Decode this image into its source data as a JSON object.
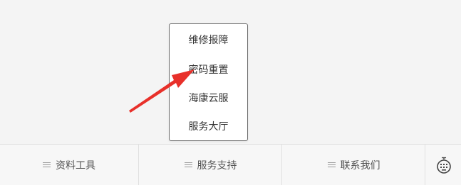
{
  "popup_menu": {
    "items": [
      {
        "label": "维修报障"
      },
      {
        "label": "密码重置"
      },
      {
        "label": "海康云服"
      },
      {
        "label": "服务大厅"
      }
    ]
  },
  "tab_bar": {
    "tabs": [
      {
        "label": "资料工具",
        "icon": "menu-lines-icon"
      },
      {
        "label": "服务支持",
        "icon": "menu-lines-icon"
      },
      {
        "label": "联系我们",
        "icon": "menu-lines-icon"
      }
    ],
    "keyboard_icon": "keyboard-icon"
  },
  "annotation": {
    "arrow_color": "#e8302a",
    "arrow_target": "密码重置"
  },
  "colors": {
    "background": "#f4f4f4",
    "popup_border": "#6f6f6f",
    "text": "#333333",
    "tab_text": "#555555"
  }
}
